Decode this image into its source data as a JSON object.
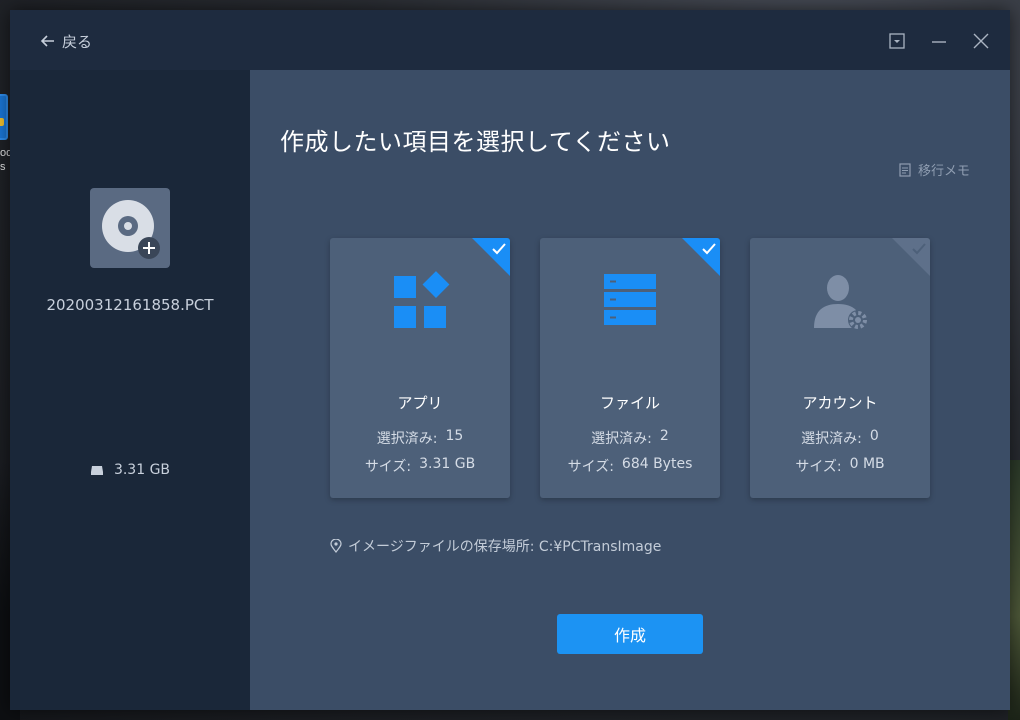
{
  "desktop": {
    "icon_label": "od\ns"
  },
  "header": {
    "back_label": "戻る"
  },
  "sidebar": {
    "image_name": "20200312161858.PCT",
    "size": "3.31 GB"
  },
  "main": {
    "title": "作成したい項目を選択してください",
    "memo_label": "移行メモ",
    "cards": [
      {
        "label": "アプリ",
        "selected_label": "選択済み:",
        "selected_count": "15",
        "size_label": "サイズ:",
        "size_value": "3.31 GB",
        "checked": true,
        "icon": "apps-icon"
      },
      {
        "label": "ファイル",
        "selected_label": "選択済み:",
        "selected_count": "2",
        "size_label": "サイズ:",
        "size_value": "684 Bytes",
        "checked": true,
        "icon": "files-icon"
      },
      {
        "label": "アカウント",
        "selected_label": "選択済み:",
        "selected_count": "0",
        "size_label": "サイズ:",
        "size_value": "0 MB",
        "checked": false,
        "icon": "account-icon"
      }
    ],
    "save_location": "イメージファイルの保存場所: C:¥PCTransImage",
    "create_button": "作成"
  },
  "colors": {
    "accent": "#1c93f3",
    "sidebar_bg": "#1a2739",
    "main_bg": "#3b4d66",
    "card_bg": "#4d6079"
  }
}
